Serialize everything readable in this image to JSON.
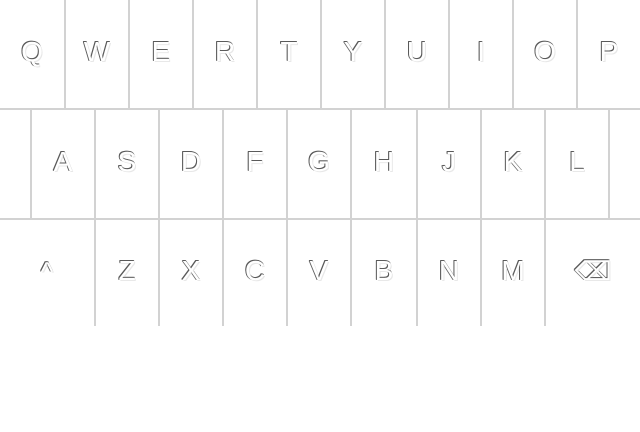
{
  "keyboard": {
    "row1": [
      "Q",
      "W",
      "E",
      "R",
      "T",
      "Y",
      "U",
      "I",
      "O",
      "P"
    ],
    "row2": [
      "A",
      "S",
      "D",
      "F",
      "G",
      "H",
      "J",
      "K",
      "L"
    ],
    "row3": [
      "Z",
      "X",
      "C",
      "V",
      "B",
      "N",
      "M"
    ],
    "shift_icon": "^",
    "backspace_icon": "⌫"
  }
}
